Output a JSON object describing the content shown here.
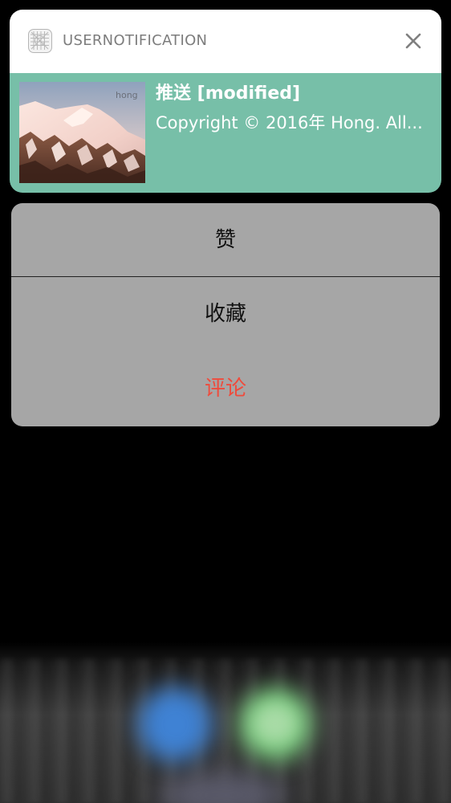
{
  "notification": {
    "app_name": "USERNOTIFICATION",
    "app_icon": "grid-app-icon",
    "close_icon": "close-icon",
    "title": "推送 [modified]",
    "message": "Copyright © 2016年 Hong. All...",
    "thumbnail_watermark": "hong",
    "header_color": "#ffffff",
    "body_color": "#77bfa8"
  },
  "actions": {
    "like_label": "赞",
    "favorite_label": "收藏",
    "comment_label": "评论",
    "destructive_color": "#ef4b3c",
    "sheet_color": "#a6a6a6"
  }
}
